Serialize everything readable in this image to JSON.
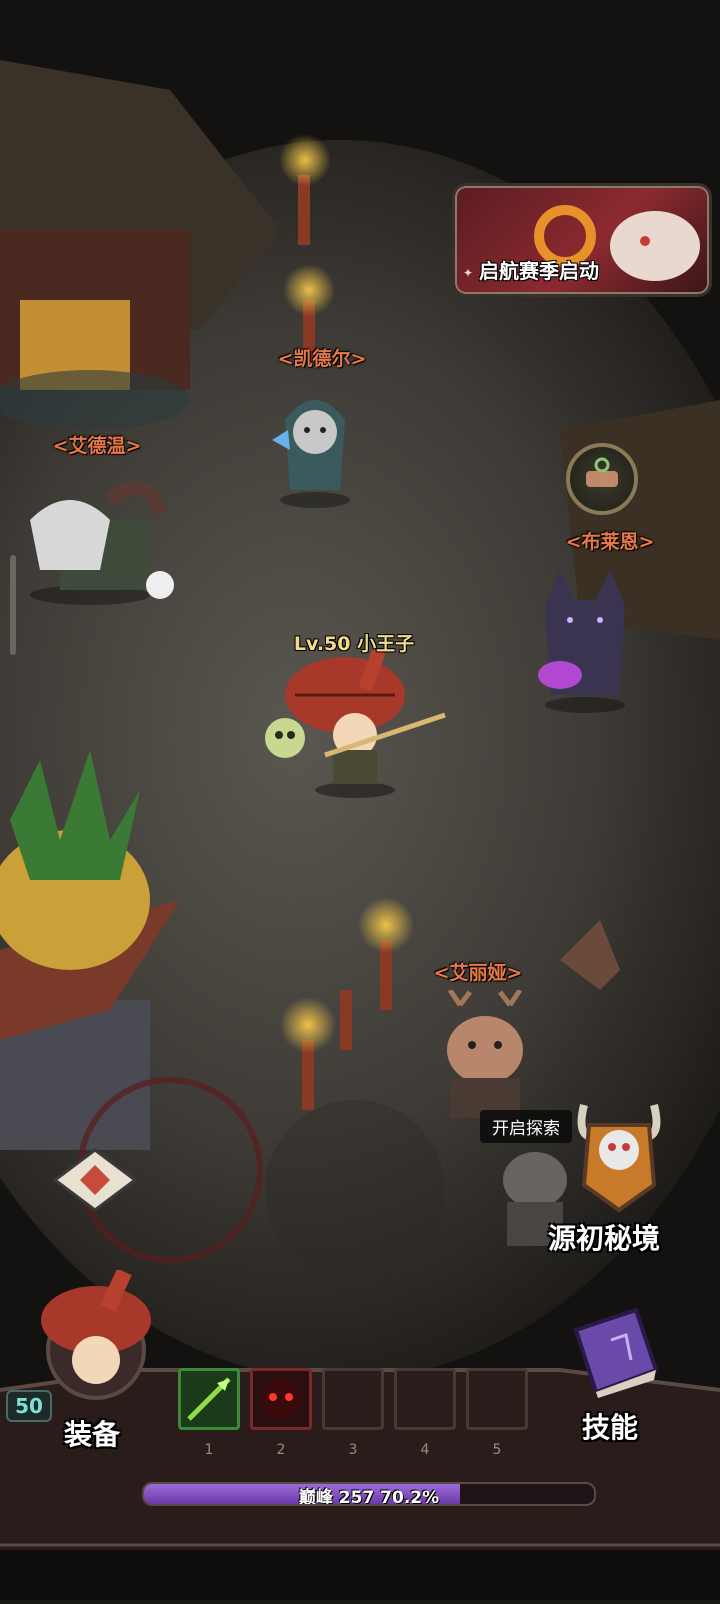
{
  "event_banner": {
    "label": "启航赛季启动",
    "icon": "sparkle-icon"
  },
  "npcs": {
    "kaider": "<凯德尔>",
    "aidewen": "<艾德温>",
    "bulaien": "<布莱恩>",
    "ailiya": "<艾丽娅>"
  },
  "player": {
    "name": "Lv.50 小王子"
  },
  "explore": {
    "tooltip": "开启探索"
  },
  "dungeon": {
    "label": "源初秘境"
  },
  "hud": {
    "level": "50",
    "equip_label": "装备",
    "skill_label": "技能",
    "slots": [
      "1",
      "2",
      "3",
      "4",
      "5"
    ],
    "xp_text": "巅峰 257  70.2%",
    "xp_progress": 0.702
  },
  "colors": {
    "npc_name": "#e8784a",
    "player_name": "#f2dc8a",
    "xp_fill": "#8a55c8",
    "level_badge": "#7fe0d8"
  }
}
